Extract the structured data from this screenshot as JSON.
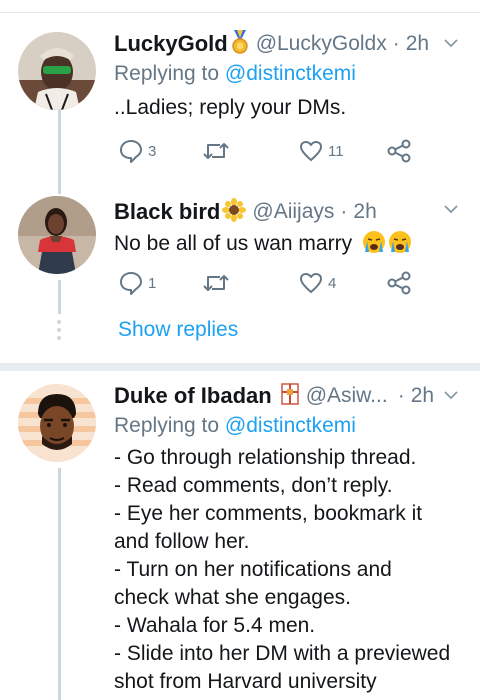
{
  "tweets": [
    {
      "name": "LuckyGold",
      "handle": "@LuckyGoldx",
      "time": "2h",
      "replying_prefix": "Replying to ",
      "replying_to": "@distinctkemi",
      "text": "..Ladies; reply your DMs.",
      "replies": "3",
      "retweets": "",
      "likes": "11",
      "name_emoji": "medal-icon"
    },
    {
      "name": "Black bird",
      "handle": "@Aiijays",
      "time": "2h",
      "text": "No be all of us wan marry",
      "replies": "1",
      "retweets": "",
      "likes": "4",
      "name_emoji": "sunflower-icon",
      "text_emoji": "crying-face-icon"
    },
    {
      "name": "Duke of Ibadan",
      "handle": "@Asiw...",
      "time": "2h",
      "replying_prefix": "Replying to ",
      "replying_to": "@distinctkemi",
      "lines": [
        "- Go through relationship thread.",
        "- Read comments, don’t reply.",
        "- Eye her comments, bookmark it",
        "and follow her.",
        "- Turn on her notifications and",
        "check what she engages.",
        "- Wahala for 5.4 men.",
        "- Slide into her DM with a previewed",
        "shot from Harvard university"
      ],
      "name_emoji": "flag-icon"
    }
  ],
  "show_replies": "Show replies",
  "colors": {
    "accent": "#1da1f2",
    "muted": "#657786",
    "text": "#14171a",
    "divider": "#e6ecf0"
  }
}
